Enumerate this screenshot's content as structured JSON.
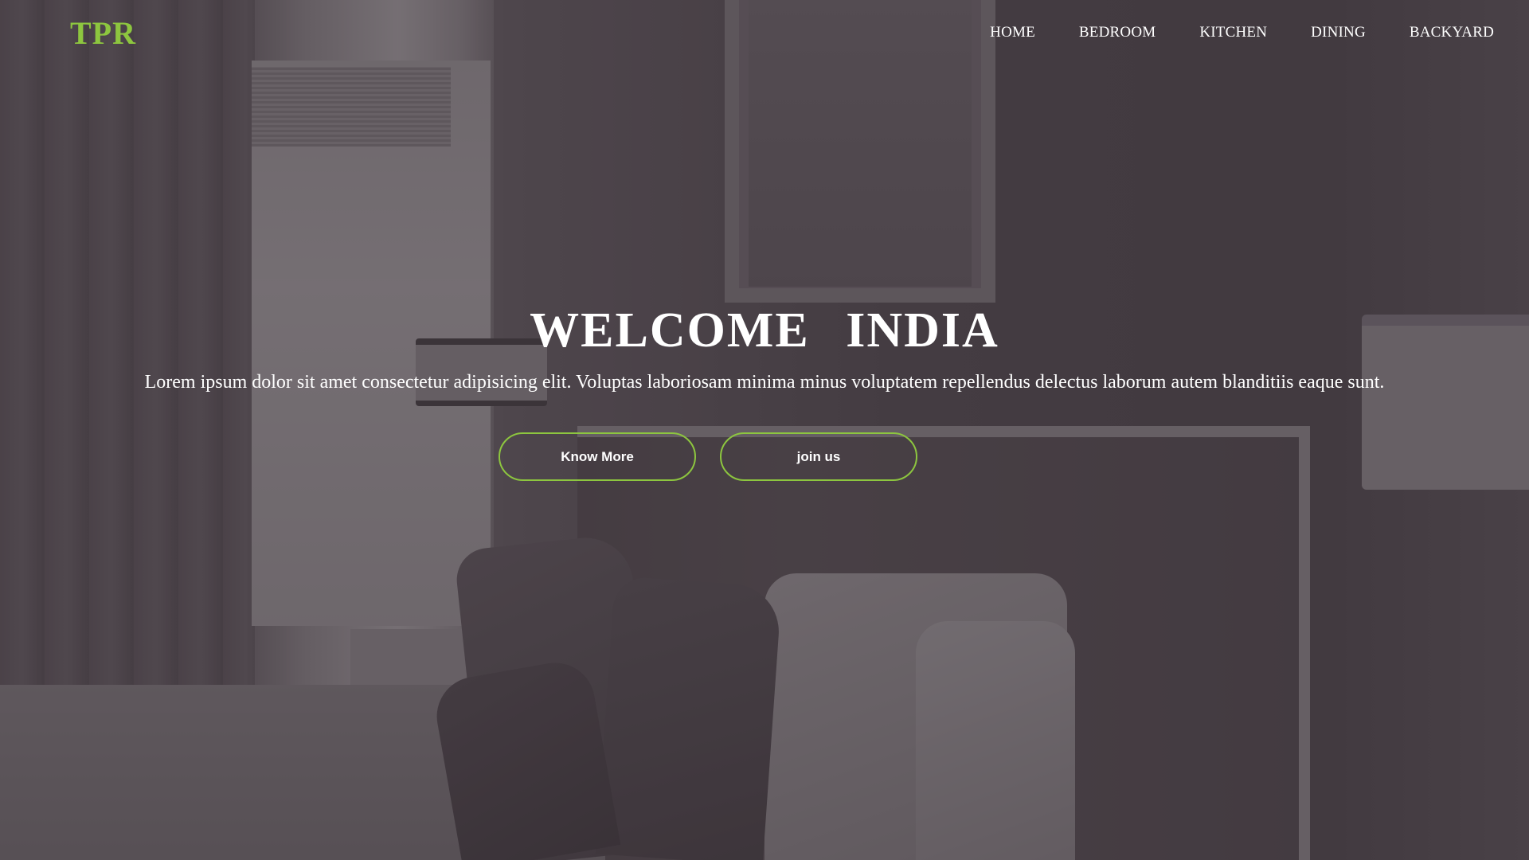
{
  "brand": {
    "logo_text": "TPR",
    "accent_color": "#8dc63f"
  },
  "nav": {
    "items": [
      {
        "label": "HOME"
      },
      {
        "label": "BEDROOM"
      },
      {
        "label": "KITCHEN"
      },
      {
        "label": "DINING"
      },
      {
        "label": "BACKYARD"
      }
    ]
  },
  "hero": {
    "title": "WELCOME INDIA",
    "subtitle": "Lorem ipsum dolor sit amet consectetur adipisicing elit. Voluptas laboriosam minima minus voluptatem repellendus delectus laborum autem blanditiis eaque sunt.",
    "buttons": {
      "primary_label": "Know More",
      "secondary_label": "join us"
    },
    "background": "bedroom-photo"
  }
}
